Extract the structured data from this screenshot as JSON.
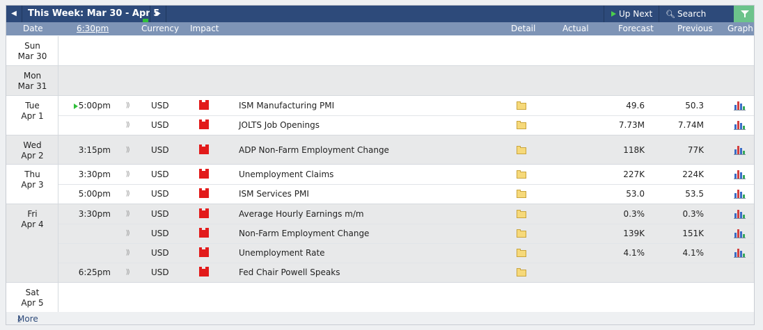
{
  "toolbar": {
    "prev_icon": "◀",
    "next_icon": "▶",
    "week_title": "This Week: Mar 30 - Apr 5",
    "up_next_label": "Up Next",
    "search_icon": "search-icon",
    "search_label": "Search Events",
    "filter_icon": "filter-icon"
  },
  "columns": {
    "date": "Date",
    "time": "6:30pm",
    "currency": "Currency",
    "impact": "Impact",
    "detail": "Detail",
    "actual": "Actual",
    "forecast": "Forecast",
    "previous": "Previous",
    "graph": "Graph"
  },
  "colors": {
    "toolbar_bg": "#2d4a7a",
    "header_bg": "#7e94b6",
    "impact_high": "#e21b1b",
    "filter_bg": "#6cc38b",
    "up_next_marker": "#2fbf3a"
  },
  "days": [
    {
      "day": "Sun",
      "date": "Mar 30",
      "events": []
    },
    {
      "day": "Mon",
      "date": "Mar 31",
      "events": []
    },
    {
      "day": "Tue",
      "date": "Apr 1",
      "events": [
        {
          "time": "5:00pm",
          "currency": "USD",
          "impact": "high",
          "title": "ISM Manufacturing PMI",
          "actual": "",
          "forecast": "49.6",
          "previous": "50.3"
        },
        {
          "time": "",
          "currency": "USD",
          "impact": "high",
          "title": "JOLTS Job Openings",
          "actual": "",
          "forecast": "7.73M",
          "previous": "7.74M"
        }
      ]
    },
    {
      "day": "Wed",
      "date": "Apr 2",
      "events": [
        {
          "time": "3:15pm",
          "currency": "USD",
          "impact": "high",
          "title": "ADP Non-Farm Employment Change",
          "actual": "",
          "forecast": "118K",
          "previous": "77K"
        }
      ]
    },
    {
      "day": "Thu",
      "date": "Apr 3",
      "events": [
        {
          "time": "3:30pm",
          "currency": "USD",
          "impact": "high",
          "title": "Unemployment Claims",
          "actual": "",
          "forecast": "227K",
          "previous": "224K"
        },
        {
          "time": "5:00pm",
          "currency": "USD",
          "impact": "high",
          "title": "ISM Services PMI",
          "actual": "",
          "forecast": "53.0",
          "previous": "53.5"
        }
      ]
    },
    {
      "day": "Fri",
      "date": "Apr 4",
      "events": [
        {
          "time": "3:30pm",
          "currency": "USD",
          "impact": "high",
          "title": "Average Hourly Earnings m/m",
          "actual": "",
          "forecast": "0.3%",
          "previous": "0.3%"
        },
        {
          "time": "",
          "currency": "USD",
          "impact": "high",
          "title": "Non-Farm Employment Change",
          "actual": "",
          "forecast": "139K",
          "previous": "151K"
        },
        {
          "time": "",
          "currency": "USD",
          "impact": "high",
          "title": "Unemployment Rate",
          "actual": "",
          "forecast": "4.1%",
          "previous": "4.1%"
        },
        {
          "time": "6:25pm",
          "currency": "USD",
          "impact": "high",
          "title": "Fed Chair Powell Speaks",
          "actual": "",
          "forecast": "",
          "previous": ""
        }
      ]
    },
    {
      "day": "Sat",
      "date": "Apr 5",
      "events": []
    }
  ],
  "footer": {
    "more_icon": "⤓",
    "more_label": "More"
  }
}
